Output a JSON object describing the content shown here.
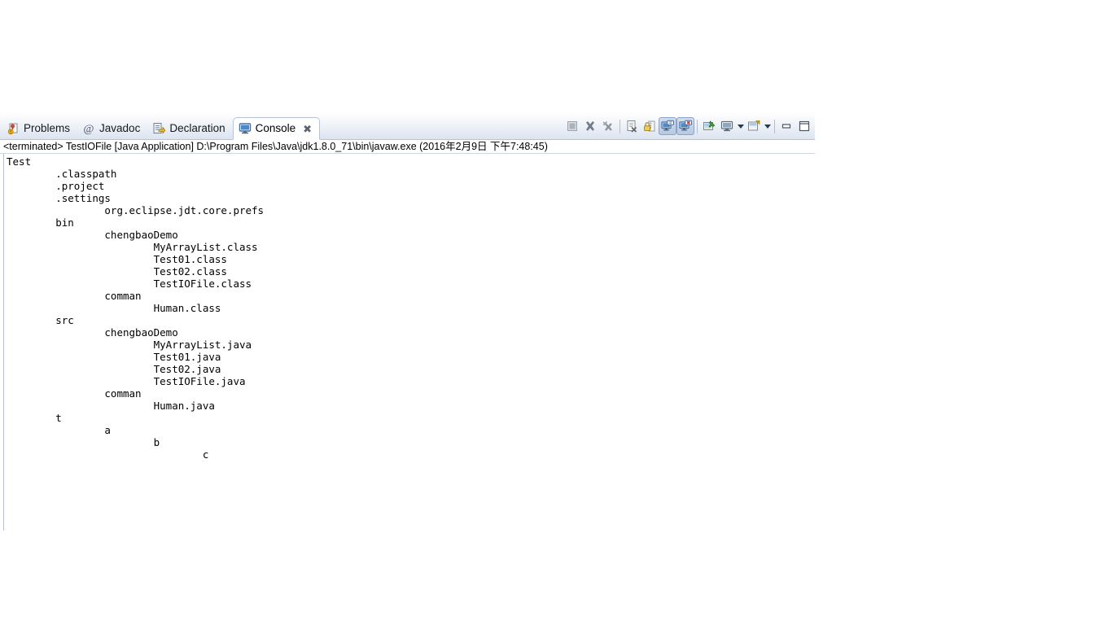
{
  "view": {
    "name": "console-view",
    "tabs": [
      {
        "label": "Problems",
        "icon": "problems-icon",
        "active": false,
        "closable": false
      },
      {
        "label": "Javadoc",
        "icon": "javadoc-icon",
        "active": false,
        "closable": false
      },
      {
        "label": "Declaration",
        "icon": "declaration-icon",
        "active": false,
        "closable": false
      },
      {
        "label": "Console",
        "icon": "console-icon",
        "active": true,
        "closable": true
      }
    ],
    "tab_close_glyph": "✖"
  },
  "toolbar": {
    "buttons": [
      {
        "name": "terminate-button",
        "icon": "stop-square-icon",
        "pressed": false,
        "enabled": false
      },
      {
        "name": "remove-launch-button",
        "icon": "remove-x-icon",
        "pressed": false,
        "enabled": true
      },
      {
        "name": "remove-all-terminated-button",
        "icon": "remove-all-x-icon",
        "pressed": false,
        "enabled": true
      },
      {
        "name": "clear-console-button",
        "icon": "clear-console-icon",
        "pressed": false,
        "enabled": true
      },
      {
        "name": "scroll-lock-button",
        "icon": "scroll-lock-icon",
        "pressed": false,
        "enabled": true
      },
      {
        "name": "show-console-on-output-button",
        "icon": "console-output-icon",
        "pressed": true,
        "enabled": true
      },
      {
        "name": "show-console-on-error-button",
        "icon": "console-error-icon",
        "pressed": true,
        "enabled": true
      },
      {
        "name": "pin-console-button",
        "icon": "pin-console-icon",
        "pressed": false,
        "enabled": true
      },
      {
        "name": "display-selected-console-button",
        "icon": "display-console-icon",
        "pressed": false,
        "enabled": true
      },
      {
        "name": "open-console-button",
        "icon": "open-console-icon",
        "pressed": false,
        "enabled": true
      },
      {
        "name": "minimize-button",
        "icon": "minimize-icon",
        "pressed": false,
        "enabled": true
      },
      {
        "name": "maximize-button",
        "icon": "maximize-icon",
        "pressed": false,
        "enabled": true
      }
    ]
  },
  "status": {
    "text": "<terminated> TestIOFile [Java Application] D:\\Program Files\\Java\\jdk1.8.0_71\\bin\\javaw.exe (2016年2月9日 下午7:48:45)"
  },
  "console": {
    "output": "Test\n        .classpath\n        .project\n        .settings\n                org.eclipse.jdt.core.prefs\n        bin\n                chengbaoDemo\n                        MyArrayList.class\n                        Test01.class\n                        Test02.class\n                        TestIOFile.class\n                comman\n                        Human.class\n        src\n                chengbaoDemo\n                        MyArrayList.java\n                        Test01.java\n                        Test02.java\n                        TestIOFile.java\n                comman\n                        Human.java\n        t\n                a\n                        b\n                                c",
    "lines": [
      {
        "indent": 0,
        "text": "Test"
      },
      {
        "indent": 1,
        "text": ".classpath"
      },
      {
        "indent": 1,
        "text": ".project"
      },
      {
        "indent": 1,
        "text": ".settings"
      },
      {
        "indent": 2,
        "text": "org.eclipse.jdt.core.prefs"
      },
      {
        "indent": 1,
        "text": "bin"
      },
      {
        "indent": 2,
        "text": "chengbaoDemo"
      },
      {
        "indent": 3,
        "text": "MyArrayList.class"
      },
      {
        "indent": 3,
        "text": "Test01.class"
      },
      {
        "indent": 3,
        "text": "Test02.class"
      },
      {
        "indent": 3,
        "text": "TestIOFile.class"
      },
      {
        "indent": 2,
        "text": "comman"
      },
      {
        "indent": 3,
        "text": "Human.class"
      },
      {
        "indent": 1,
        "text": "src"
      },
      {
        "indent": 2,
        "text": "chengbaoDemo"
      },
      {
        "indent": 3,
        "text": "MyArrayList.java"
      },
      {
        "indent": 3,
        "text": "Test01.java"
      },
      {
        "indent": 3,
        "text": "Test02.java"
      },
      {
        "indent": 3,
        "text": "TestIOFile.java"
      },
      {
        "indent": 2,
        "text": "comman"
      },
      {
        "indent": 3,
        "text": "Human.java"
      },
      {
        "indent": 1,
        "text": "t"
      },
      {
        "indent": 2,
        "text": "a"
      },
      {
        "indent": 3,
        "text": "b"
      },
      {
        "indent": 4,
        "text": "c"
      }
    ]
  },
  "colors": {
    "tab_active_bg": "#ffffff",
    "tab_strip_bg": "#dce4f0",
    "border": "#b8c4d6",
    "text": "#000000",
    "pressed_button": "#b7cae3"
  }
}
